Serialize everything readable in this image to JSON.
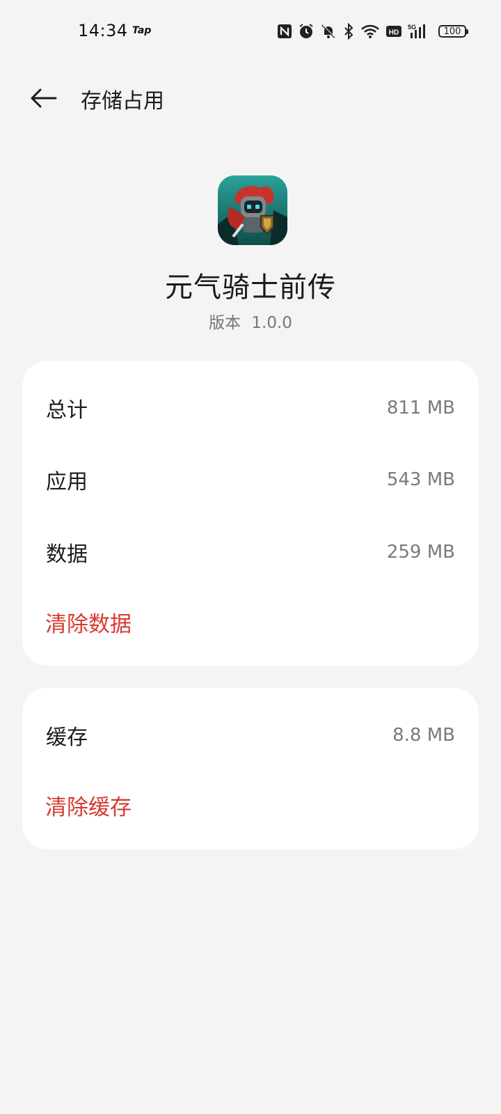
{
  "status_bar": {
    "time": "14:34",
    "tap_label": "Tap",
    "battery": "100",
    "icons": [
      "nfc-icon",
      "alarm-icon",
      "bell-muted-icon",
      "bluetooth-icon",
      "wifi-icon",
      "hd-icon",
      "signal-5g-icon",
      "battery-icon"
    ],
    "hd_label": "HD",
    "net_label": "5G"
  },
  "header": {
    "title": "存储占用"
  },
  "app": {
    "name": "元气骑士前传",
    "version_label": "版本",
    "version_value": "1.0.0"
  },
  "storage": {
    "rows": [
      {
        "label": "总计",
        "value": "811 MB"
      },
      {
        "label": "应用",
        "value": "543 MB"
      },
      {
        "label": "数据",
        "value": "259 MB"
      }
    ],
    "clear_data_label": "清除数据"
  },
  "cache": {
    "label": "缓存",
    "value": "8.8 MB",
    "clear_cache_label": "清除缓存"
  },
  "colors": {
    "background": "#f4f4f4",
    "card": "#ffffff",
    "accent_red": "#d7392e",
    "secondary_text": "#7a7a7a"
  }
}
